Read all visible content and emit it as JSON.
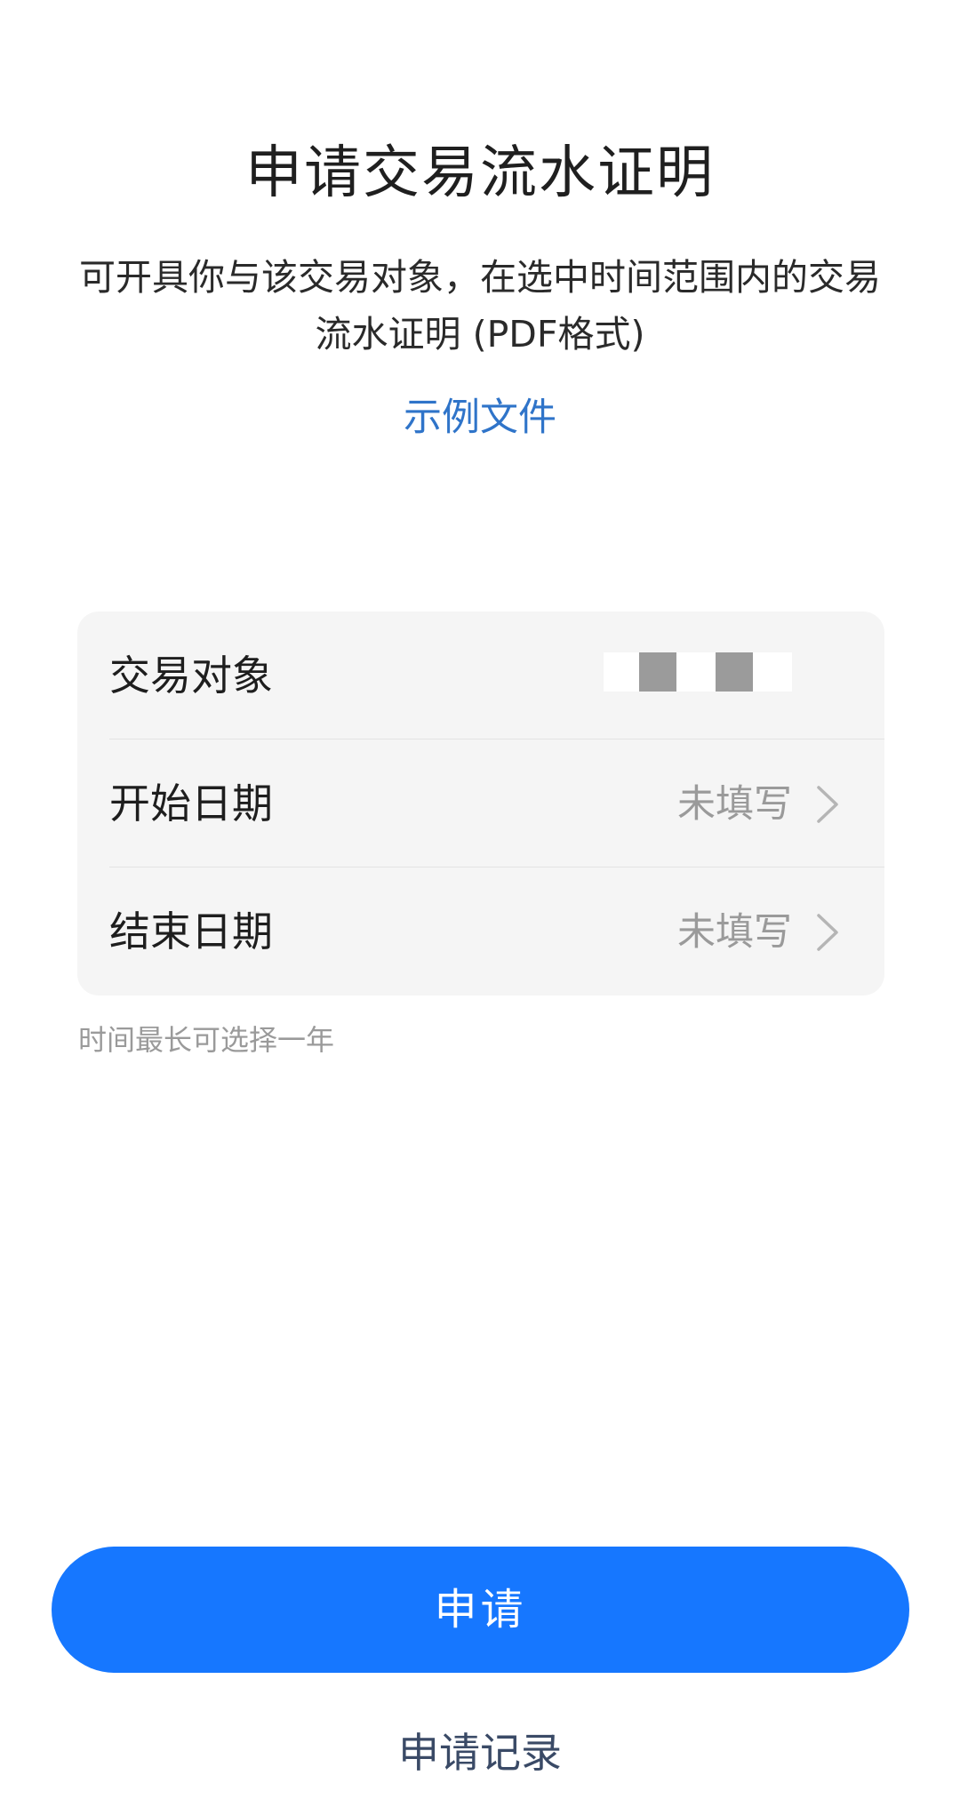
{
  "page": {
    "title": "申请交易流水证明",
    "subtitle": "可开具你与该交易对象，在选中时间范围内的交易流水证明 (PDF格式)",
    "sample_link": "示例文件"
  },
  "form": {
    "rows": [
      {
        "label": "交易对象",
        "value": ""
      },
      {
        "label": "开始日期",
        "value": "未填写",
        "icon": "chevron-right-icon"
      },
      {
        "label": "结束日期",
        "value": "未填写",
        "icon": "chevron-right-icon"
      }
    ],
    "hint": "时间最长可选择一年"
  },
  "actions": {
    "apply_label": "申请",
    "records_label": "申请记录"
  },
  "colors": {
    "primary": "#1677ff",
    "link": "#2f74c9",
    "placeholder": "#9a9a9a",
    "card_bg": "#f5f5f5"
  }
}
